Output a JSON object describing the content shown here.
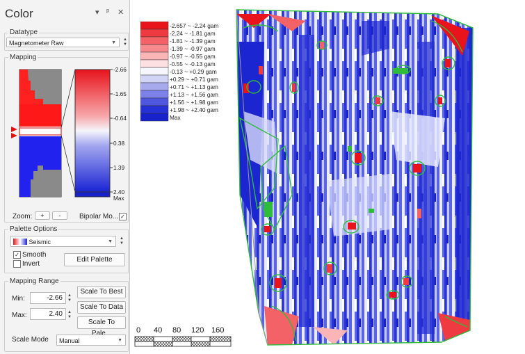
{
  "panel": {
    "title": "Color",
    "controls": {
      "dropdown": "▾",
      "pin": "ᵖ",
      "close": "✕"
    },
    "datatype": {
      "label": "Datatype",
      "value": "Magnetometer Raw"
    },
    "mapping": {
      "label": "Mapping",
      "ticks": [
        "-2.66",
        "-1.65",
        "-0.64",
        "0.38",
        "1.39",
        "2.40",
        "Max"
      ],
      "zoom_label": "Zoom:",
      "zoom_in": "+",
      "zoom_out": "-",
      "bipolar_label": "Bipolar Mo...",
      "bipolar_checked": true
    },
    "palette_options": {
      "label": "Palette Options",
      "palette_name": "Seismic",
      "smooth_label": "Smooth",
      "smooth_checked": true,
      "invert_label": "Invert",
      "invert_checked": false,
      "edit_button": "Edit Palette"
    },
    "mapping_range": {
      "label": "Mapping Range",
      "min_label": "Min:",
      "min_value": "-2.66",
      "max_label": "Max:",
      "max_value": "2.40",
      "scale_best": "Scale To Best",
      "scale_data": "Scale To Data",
      "scale_palette": "Scale To Pale...",
      "mode_label": "Scale Mode",
      "mode_value": "Manual"
    }
  },
  "legend": {
    "entries": [
      {
        "label": "-2.657 ~ -2.24 gam",
        "color": "#e8131b"
      },
      {
        "label": "-2.24 ~ -1.81 gam",
        "color": "#ee3a40"
      },
      {
        "label": "-1.81 ~ -1.39 gam",
        "color": "#f36267"
      },
      {
        "label": "-1.39 ~ -0.97 gam",
        "color": "#f78a8e"
      },
      {
        "label": "-0.97 ~ -0.55 gam",
        "color": "#fbb5b7"
      },
      {
        "label": "-0.55 ~ -0.13 gam",
        "color": "#fde0e1"
      },
      {
        "label": "-0.13 ~ +0.29 gam",
        "color": "#f6f6fd"
      },
      {
        "label": "+0.29 ~ +0.71 gam",
        "color": "#d2d4f6"
      },
      {
        "label": "+0.71 ~ +1.13 gam",
        "color": "#a7abee"
      },
      {
        "label": "+1.13 ~ +1.56 gam",
        "color": "#7b81e6"
      },
      {
        "label": "+1.56 ~ +1.98 gam",
        "color": "#4f57de"
      },
      {
        "label": "+1.98 ~ +2.40 gam",
        "color": "#2631d6"
      },
      {
        "label": "Max",
        "color": "#1822cc"
      }
    ]
  },
  "scale_bar": {
    "labels": [
      "0",
      "40",
      "80",
      "120",
      "160"
    ]
  }
}
